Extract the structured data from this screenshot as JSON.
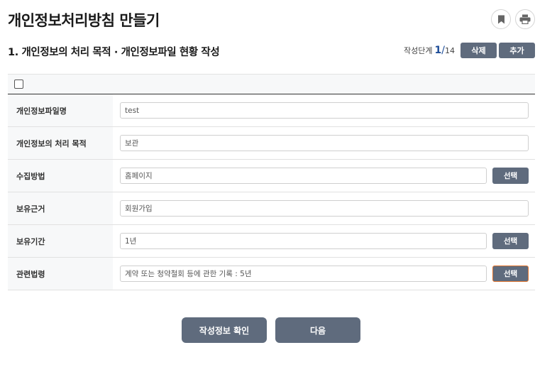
{
  "page": {
    "title": "개인정보처리방침 만들기"
  },
  "icons": {
    "bookmark": "bookmark-icon",
    "print": "print-icon"
  },
  "section": {
    "title": "1. 개인정보의 처리 목적 · 개인정보파일 현황 작성",
    "step_label": "작성단계",
    "step_current": "1",
    "step_separator": "/",
    "step_total": "14",
    "delete_label": "삭제",
    "add_label": "추가"
  },
  "form": {
    "rows": [
      {
        "label": "개인정보파일명",
        "value": "test"
      },
      {
        "label": "개인정보의 처리 목적",
        "value": "보관"
      },
      {
        "label": "수집방법",
        "value": "홈페이지",
        "button": "선택"
      },
      {
        "label": "보유근거",
        "value": "회원가입"
      },
      {
        "label": "보유기간",
        "value": "1년",
        "button": "선택"
      },
      {
        "label": "관련법령",
        "value": "계약 또는 청약철회 등에 관한 기록 : 5년",
        "button": "선택"
      }
    ]
  },
  "footer": {
    "confirm_label": "작성정보 확인",
    "next_label": "다음"
  },
  "colors": {
    "button_bg": "#5f6b7d",
    "step_accent": "#1f4e99",
    "focus_outline": "#e0742e"
  }
}
